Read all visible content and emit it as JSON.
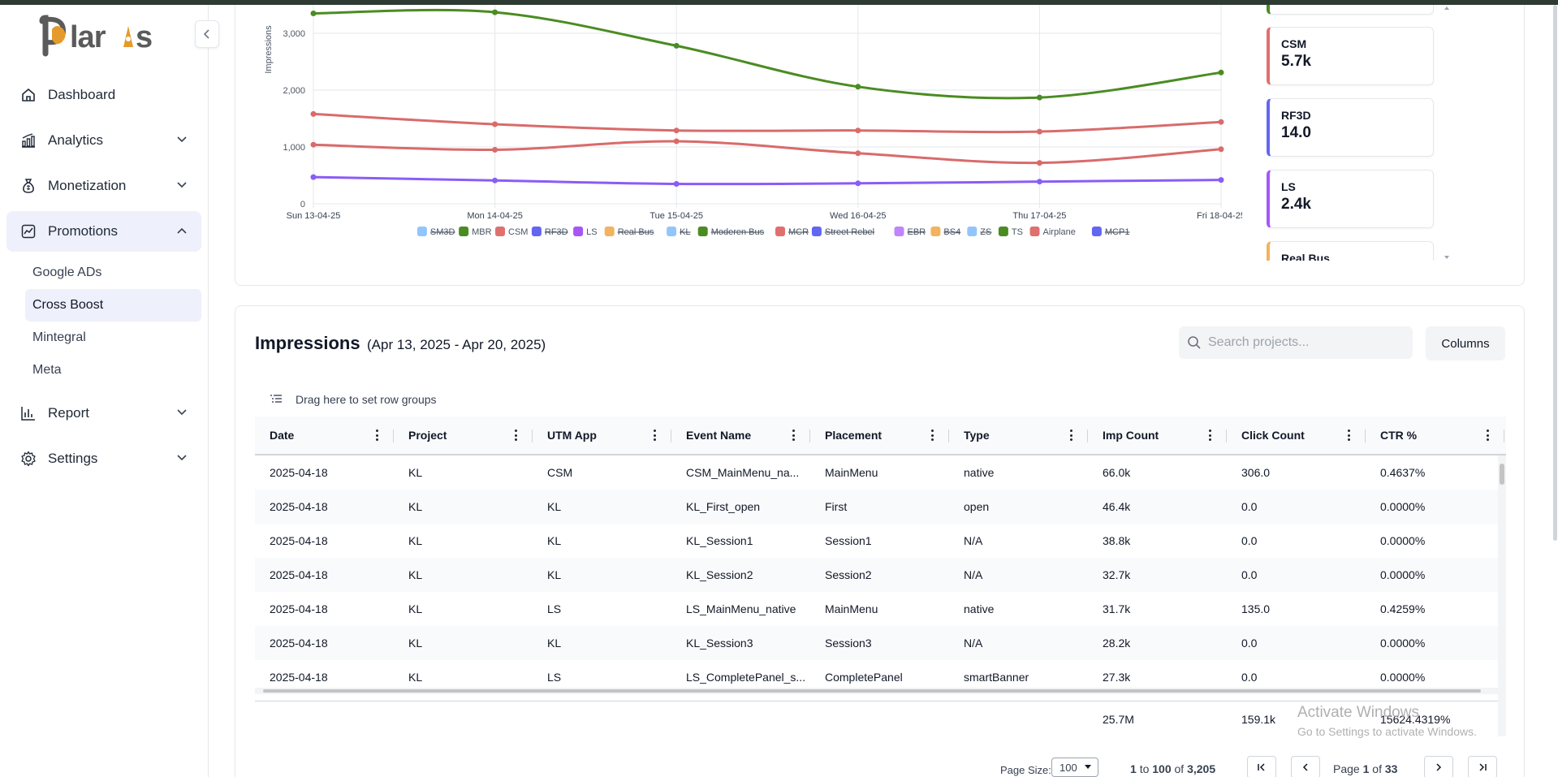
{
  "app": {
    "logo_text_left": "P",
    "logo_text_o": "o",
    "logo_text_right": "lar",
    "logo_text_i": "i",
    "logo_text_s": "s",
    "logo_full": "polaris"
  },
  "sidebar": {
    "items": [
      {
        "label": "Dashboard",
        "icon": "home-icon",
        "expanded": false
      },
      {
        "label": "Analytics",
        "icon": "analytics-icon",
        "expanded": false
      },
      {
        "label": "Monetization",
        "icon": "money-bag-icon",
        "expanded": false
      },
      {
        "label": "Promotions",
        "icon": "promotions-icon",
        "expanded": true
      },
      {
        "label": "Report",
        "icon": "report-icon",
        "expanded": false
      },
      {
        "label": "Settings",
        "icon": "gear-icon",
        "expanded": false
      }
    ],
    "promotions_children": [
      "Google ADs",
      "Cross Boost",
      "Mintegral",
      "Meta"
    ],
    "active_child": "Cross Boost"
  },
  "chart_data": {
    "type": "line",
    "ylabel": "Impressions",
    "xlabel": "",
    "x": [
      "Sun 13-04-25",
      "Mon 14-04-25",
      "Tue 15-04-25",
      "Wed 16-04-25",
      "Thu 17-04-25",
      "Fri 18-04-25"
    ],
    "ylim": [
      0,
      3500
    ],
    "yticks": [
      "0",
      "1,000",
      "2,000",
      "3,000"
    ],
    "grid": true,
    "legend_position": "bottom",
    "series": [
      {
        "name": "MBR",
        "color": "#4a8c22",
        "values": [
          3350,
          3370,
          2780,
          2060,
          1870,
          2310
        ]
      },
      {
        "name": "CSM",
        "color": "#d96b6b",
        "values": [
          1580,
          1400,
          1290,
          1290,
          1270,
          1440
        ]
      },
      {
        "name": "Airplane",
        "color": "#d96b6b",
        "values": [
          1040,
          950,
          1100,
          890,
          720,
          960
        ]
      },
      {
        "name": "LS",
        "color": "#8b5cf6",
        "values": [
          470,
          410,
          350,
          360,
          390,
          420
        ]
      }
    ],
    "legend": [
      {
        "name": "SM3D",
        "color": "#93c5fd",
        "hidden": true
      },
      {
        "name": "MBR",
        "color": "#4a8c22",
        "hidden": false
      },
      {
        "name": "CSM",
        "color": "#e07070",
        "hidden": false
      },
      {
        "name": "RF3D",
        "color": "#6366f1",
        "hidden": true
      },
      {
        "name": "LS",
        "color": "#a855f7",
        "hidden": false
      },
      {
        "name": "Real Bus",
        "color": "#f2b35e",
        "hidden": true
      },
      {
        "name": "KL",
        "color": "#93c5fd",
        "hidden": true
      },
      {
        "name": "Moderen Bus",
        "color": "#4a8c22",
        "hidden": true
      },
      {
        "name": "MCR",
        "color": "#e07070",
        "hidden": true
      },
      {
        "name": "Street Rebel",
        "color": "#6366f1",
        "hidden": true
      },
      {
        "name": "EBR",
        "color": "#c084fc",
        "hidden": true
      },
      {
        "name": "BS4",
        "color": "#f2b35e",
        "hidden": true
      },
      {
        "name": "ZS",
        "color": "#93c5fd",
        "hidden": true
      },
      {
        "name": "TS",
        "color": "#4a8c22",
        "hidden": false
      },
      {
        "name": "Airplane",
        "color": "#e07070",
        "hidden": false
      },
      {
        "name": "MCP1",
        "color": "#6366f1",
        "hidden": true
      }
    ]
  },
  "stats": [
    {
      "label": "CSM",
      "value": "5.7k",
      "color": "#e07070"
    },
    {
      "label": "RF3D",
      "value": "14.0",
      "color": "#6366f1"
    },
    {
      "label": "LS",
      "value": "2.4k",
      "color": "#a855f7"
    },
    {
      "label": "Real Bus",
      "value": "",
      "color": "#f2b35e"
    }
  ],
  "table": {
    "title": "Impressions",
    "date_range": "(Apr 13, 2025 - Apr 20, 2025)",
    "search_placeholder": "Search projects...",
    "columns_button": "Columns",
    "group_hint": "Drag here to set row groups",
    "headers": [
      "Date",
      "Project",
      "UTM App",
      "Event Name",
      "Placement",
      "Type",
      "Imp Count",
      "Click Count",
      "CTR %"
    ],
    "rows": [
      [
        "2025-04-18",
        "KL",
        "CSM",
        "CSM_MainMenu_na...",
        "MainMenu",
        "native",
        "66.0k",
        "306.0",
        "0.4637%"
      ],
      [
        "2025-04-18",
        "KL",
        "KL",
        "KL_First_open",
        "First",
        "open",
        "46.4k",
        "0.0",
        "0.0000%"
      ],
      [
        "2025-04-18",
        "KL",
        "KL",
        "KL_Session1",
        "Session1",
        "N/A",
        "38.8k",
        "0.0",
        "0.0000%"
      ],
      [
        "2025-04-18",
        "KL",
        "KL",
        "KL_Session2",
        "Session2",
        "N/A",
        "32.7k",
        "0.0",
        "0.0000%"
      ],
      [
        "2025-04-18",
        "KL",
        "LS",
        "LS_MainMenu_native",
        "MainMenu",
        "native",
        "31.7k",
        "135.0",
        "0.4259%"
      ],
      [
        "2025-04-18",
        "KL",
        "KL",
        "KL_Session3",
        "Session3",
        "N/A",
        "28.2k",
        "0.0",
        "0.0000%"
      ],
      [
        "2025-04-18",
        "KL",
        "LS",
        "LS_CompletePanel_s...",
        "CompletePanel",
        "smartBanner",
        "27.3k",
        "0.0",
        "0.0000%"
      ]
    ],
    "totals": [
      "",
      "",
      "",
      "",
      "",
      "",
      "25.7M",
      "159.1k",
      "15624.4319%"
    ],
    "pager": {
      "page_size_label": "Page Size:",
      "page_size": "100",
      "range_from": "1",
      "range_to_word": "to",
      "range_to": "100",
      "of_word": "of",
      "total": "3,205",
      "page_word": "Page",
      "page": "1",
      "page_of": "of",
      "pages": "33"
    }
  },
  "watermark": {
    "line1": "Activate Windows",
    "line2": "Go to Settings to activate Windows."
  }
}
